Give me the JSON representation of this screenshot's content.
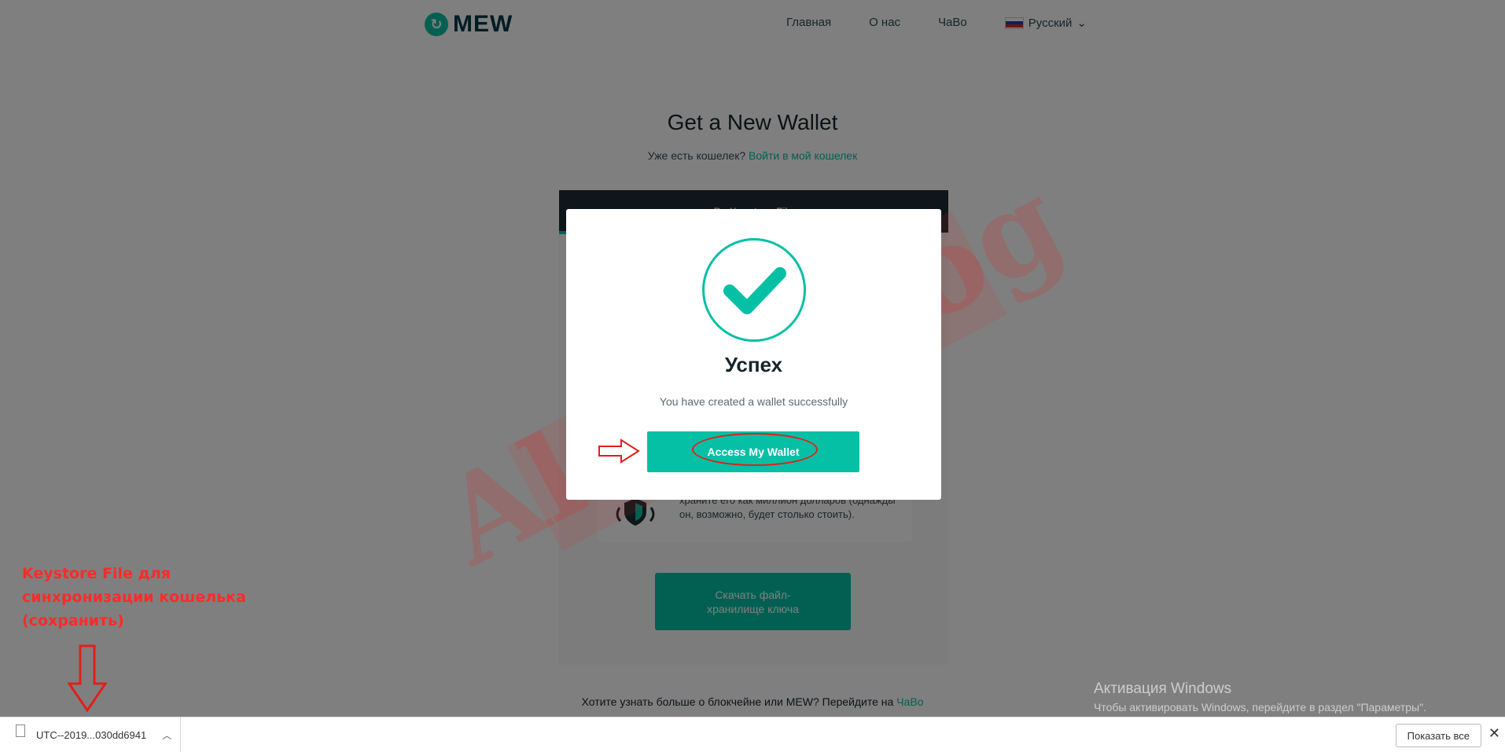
{
  "header": {
    "logo_text": "MEW",
    "nav": [
      "Главная",
      "О нас",
      "ЧаВо"
    ],
    "language": "Русский"
  },
  "hero": {
    "title": "Get a New Wallet",
    "sub_prefix": "Уже есть кошелек?",
    "sub_link": "Войти в мой кошелек"
  },
  "panel": {
    "tab_label": "By Keystore File",
    "tip_text": "храните его как миллион долларов (однажды он, возможно, будет столько стоить).",
    "download_label": "Скачать файл-хранилище ключа"
  },
  "footer": {
    "text": "Хотите узнать больше о блокчейне или MEW? Перейдите на",
    "link": "ЧаВо"
  },
  "modal": {
    "title": "Успех",
    "message": "You have created a wallet successfully",
    "button": "Access My Wallet"
  },
  "watermark": {
    "text": "Altcoinlog"
  },
  "annotation": {
    "lines": [
      "Keystore File для",
      "синхронизации кошелька",
      "(сохранить)"
    ]
  },
  "windows": {
    "title": "Активация Windows",
    "subtitle": "Чтобы активировать Windows, перейдите в раздел \"Параметры\"."
  },
  "download_bar": {
    "file_name": "UTC--2019...030dd6941",
    "show_all": "Показать все",
    "close": "✕"
  },
  "colors": {
    "accent": "#05c0a5",
    "annotation": "#ff2a2a",
    "dark": "#1d2c37"
  }
}
